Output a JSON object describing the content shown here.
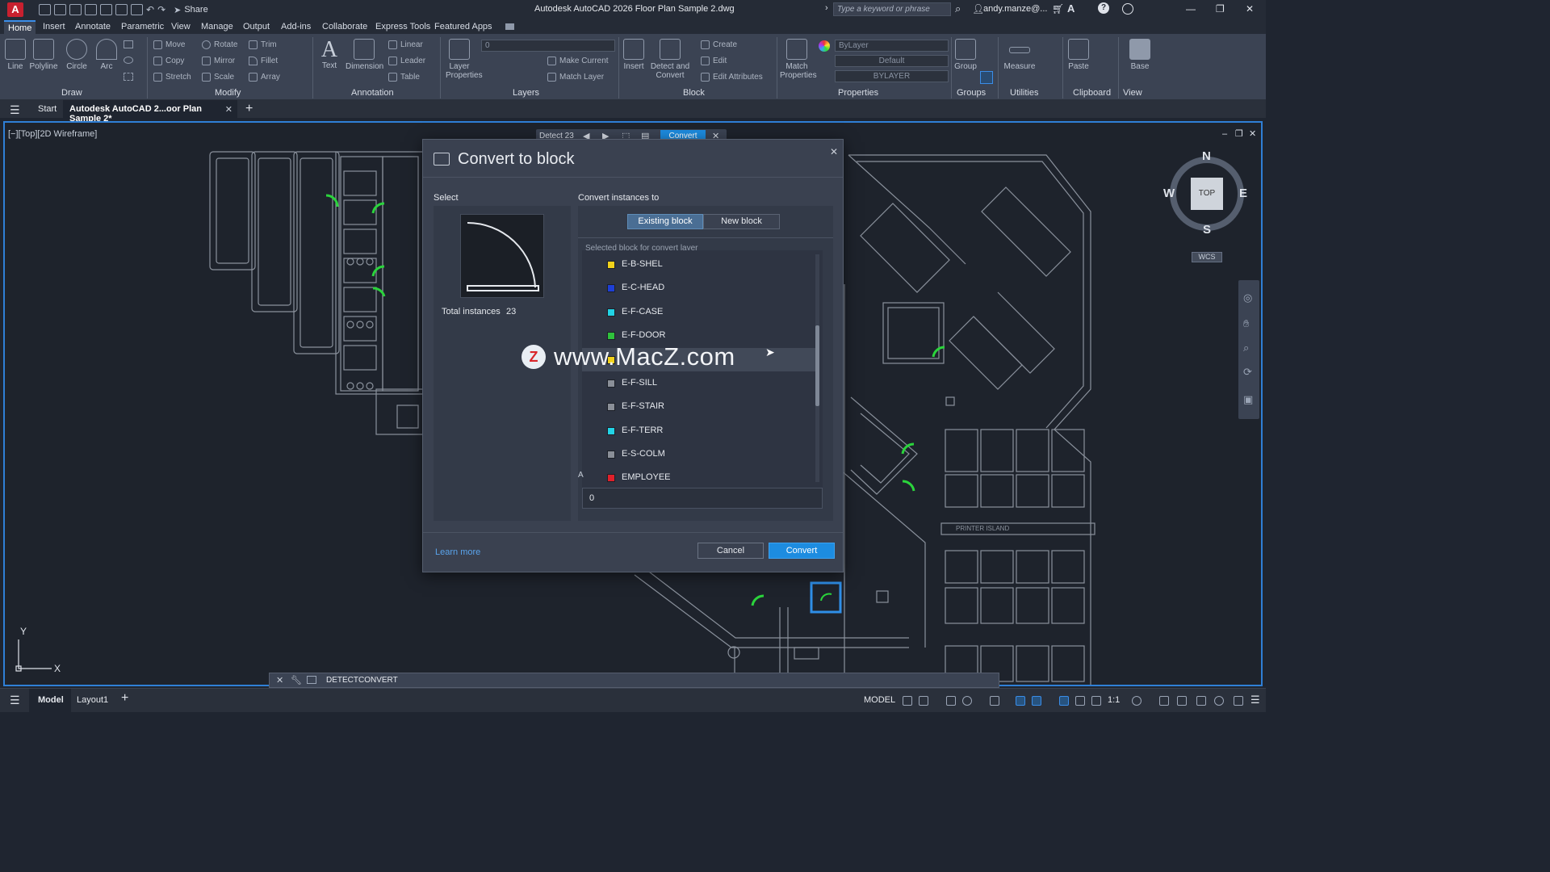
{
  "titlebar": {
    "app_logo": "A",
    "share_label": "Share",
    "title": "Autodesk AutoCAD 2026  Floor Plan Sample 2.dwg",
    "search_placeholder": "Type a keyword or phrase",
    "user": "andy.manze@..."
  },
  "ribbon_tabs": [
    "Home",
    "Insert",
    "Annotate",
    "Parametric",
    "View",
    "Manage",
    "Output",
    "Add-ins",
    "Collaborate",
    "Express Tools",
    "Featured Apps"
  ],
  "ribbon": {
    "draw": {
      "title": "Draw",
      "tools": [
        "Line",
        "Polyline",
        "Circle",
        "Arc"
      ]
    },
    "modify": {
      "title": "Modify",
      "tools": [
        "Move",
        "Rotate",
        "Trim",
        "Copy",
        "Mirror",
        "Fillet",
        "Stretch",
        "Scale",
        "Array"
      ]
    },
    "annotation": {
      "title": "Annotation",
      "big": [
        "Text",
        "Dimension"
      ],
      "small": [
        "Linear",
        "Leader",
        "Table"
      ]
    },
    "layers": {
      "title": "Layers",
      "big": "Layer Properties",
      "small": [
        "Make Current",
        "Match Layer"
      ],
      "layer_value": "0"
    },
    "block": {
      "title": "Block",
      "big": [
        "Insert",
        "Detect and Convert"
      ],
      "small": [
        "Create",
        "Edit",
        "Edit Attributes"
      ]
    },
    "properties": {
      "title": "Properties",
      "big": "Match Properties",
      "combos": [
        "ByLayer",
        "Default",
        "BYLAYER"
      ]
    },
    "groups": {
      "title": "Groups",
      "big": "Group"
    },
    "utilities": {
      "title": "Utilities",
      "big": "Measure"
    },
    "clipboard": {
      "title": "Clipboard",
      "big": "Paste"
    },
    "view": {
      "title": "View",
      "big": "Base"
    }
  },
  "file_tabs": {
    "start": "Start",
    "active": "Autodesk AutoCAD 2...oor Plan Sample 2*"
  },
  "viewport": {
    "label": "[−][Top][2D Wireframe]"
  },
  "detect_bar": {
    "label": "Detect 23",
    "convert_label": "Convert"
  },
  "dialog": {
    "title": "Convert to block",
    "select_label": "Select",
    "convert_to_label": "Convert instances to",
    "instances_label": "Total instances",
    "instances_value": "23",
    "seg_existing": "Existing block",
    "seg_new": "New block",
    "hidden_hint": "Selected block for convert layer",
    "layers": [
      {
        "name": "E-B-SHEL",
        "color": "#f2d21b"
      },
      {
        "name": "E-C-HEAD",
        "color": "#1e3fd6"
      },
      {
        "name": "E-F-CASE",
        "color": "#22d3e6"
      },
      {
        "name": "E-F-DOOR",
        "color": "#2fc13c"
      },
      {
        "name": "",
        "color": "#f2d21b"
      },
      {
        "name": "E-F-SILL",
        "color": "#8a8f98"
      },
      {
        "name": "E-F-STAIR",
        "color": "#8a8f98"
      },
      {
        "name": "E-F-TERR",
        "color": "#22d3e6"
      },
      {
        "name": "E-S-COLM",
        "color": "#8a8f98"
      },
      {
        "name": "EMPLOYEE",
        "color": "#e0202a"
      }
    ],
    "a_label": "A",
    "name_value": "0",
    "learn_more": "Learn more",
    "cancel": "Cancel",
    "convert": "Convert"
  },
  "watermark": {
    "logo": "Z",
    "text": "www.MacZ.com"
  },
  "viewcube": {
    "n": "N",
    "s": "S",
    "e": "E",
    "w": "W",
    "top": "TOP",
    "wcs": "WCS"
  },
  "drawing_labels": {
    "printer_island": "PRINTER ISLAND"
  },
  "axes": {
    "x": "X",
    "y": "Y"
  },
  "command_line": {
    "text": "DETECTCONVERT"
  },
  "status_bar": {
    "model_tab": "Model",
    "layout_tab": "Layout1",
    "model_label": "MODEL",
    "scale": "1:1"
  }
}
